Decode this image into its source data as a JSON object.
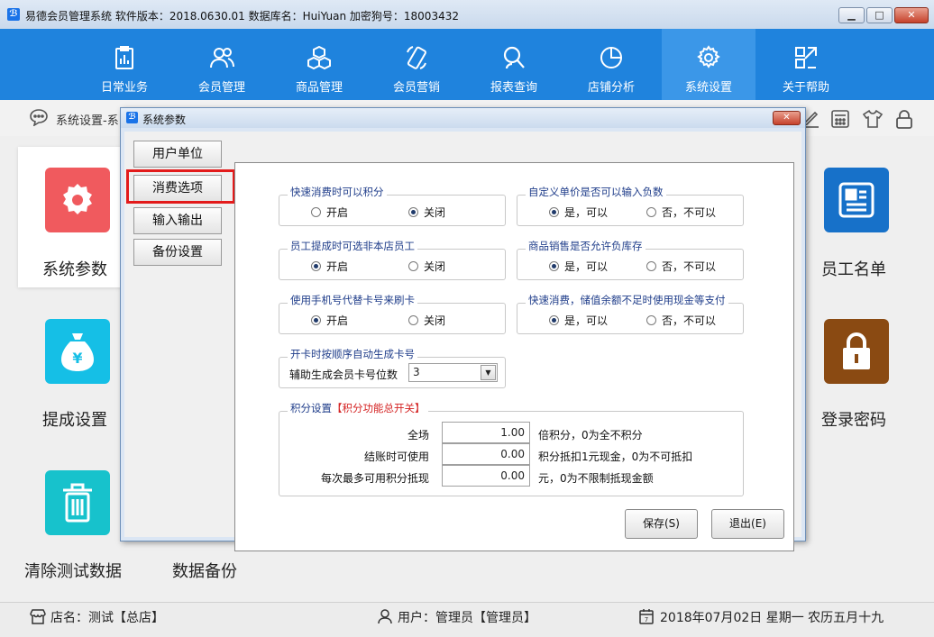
{
  "window": {
    "title": "易德会员管理系统   软件版本：2018.0630.01   数据库名：HuiYuan   加密狗号：18003432",
    "min_label": "▁",
    "max_label": "□",
    "close_label": "✕"
  },
  "nav": {
    "items": [
      {
        "label": "日常业务",
        "icon": "clipboard-chart-icon"
      },
      {
        "label": "会员管理",
        "icon": "users-icon"
      },
      {
        "label": "商品管理",
        "icon": "boxes-icon"
      },
      {
        "label": "会员营销",
        "icon": "phone-icon"
      },
      {
        "label": "报表查询",
        "icon": "search-person-icon"
      },
      {
        "label": "店铺分析",
        "icon": "pie-chart-icon"
      },
      {
        "label": "系统设置",
        "icon": "gear-icon"
      },
      {
        "label": "关于帮助",
        "icon": "help-icon"
      }
    ],
    "active_index": 6
  },
  "breadcrumb": {
    "text": "系统设置-系"
  },
  "tiles": {
    "system_params": "系统参数",
    "commission": "提成设置",
    "clear_test": "清除测试数据",
    "data_backup": "数据备份",
    "staff_list": "员工名单",
    "login_password": "登录密码"
  },
  "status": {
    "store": "店名：测试【总店】",
    "user": "用户：管理员【管理员】",
    "date": "2018年07月02日 星期一 农历五月十九"
  },
  "dialog": {
    "title": "系统参数",
    "tabs": [
      "用户单位",
      "消费选项",
      "输入输出",
      "备份设置"
    ],
    "selected_tab": 1,
    "groups": {
      "quick_points": {
        "title": "快速消费时可以积分",
        "opt_on": "开启",
        "opt_off": "关闭",
        "selected": "off"
      },
      "custom_price_negative": {
        "title": "自定义单价是否可以输入负数",
        "opt_yes": "是，可以",
        "opt_no": "否，不可以",
        "selected": "yes"
      },
      "staff_cross_store": {
        "title": "员工提成时可选非本店员工",
        "opt_on": "开启",
        "opt_off": "关闭",
        "selected": "on"
      },
      "negative_stock": {
        "title": "商品销售是否允许负库存",
        "opt_yes": "是，可以",
        "opt_no": "否，不可以",
        "selected": "yes"
      },
      "phone_as_card": {
        "title": "使用手机号代替卡号来刷卡",
        "opt_on": "开启",
        "opt_off": "关闭",
        "selected": "on"
      },
      "cash_fallback": {
        "title": "快速消费，储值余额不足时使用现金等支付",
        "opt_yes": "是，可以",
        "opt_no": "否，不可以",
        "selected": "yes"
      },
      "auto_card": {
        "title": "开卡时按顺序自动生成卡号",
        "label": "辅助生成会员卡号位数",
        "value": "3"
      },
      "points": {
        "title": "积分设置",
        "title_note": "【积分功能总开关】",
        "rows": [
          {
            "label": "全场",
            "value": "1.00",
            "hint": "倍积分，0为全不积分"
          },
          {
            "label": "结账时可使用",
            "value": "0.00",
            "hint": "积分抵扣1元现金，0为不可抵扣"
          },
          {
            "label": "每次最多可用积分抵现",
            "value": "0.00",
            "hint": "元，0为不限制抵现金额"
          }
        ]
      }
    },
    "buttons": {
      "save": "保存(S)",
      "exit": "退出(E)"
    }
  },
  "colors": {
    "nav_bg": "#1f83dd",
    "nav_active": "#3b97e8",
    "tile_red": "#f05a5e",
    "tile_cyan": "#15bfe6",
    "tile_teal": "#17c2cc",
    "tile_blue": "#1771c9",
    "tile_brown": "#8a4a12",
    "highlight": "#e31b1b"
  }
}
